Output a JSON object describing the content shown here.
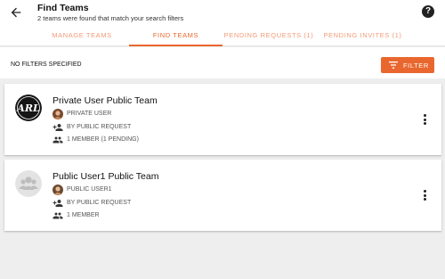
{
  "header": {
    "title": "Find Teams",
    "subtitle": "2 teams were found that match your search filters",
    "help_label": "?"
  },
  "tabs": [
    {
      "label": "MANAGE TEAMS",
      "active": false
    },
    {
      "label": "FIND TEAMS",
      "active": true
    },
    {
      "label": "PENDING REQUESTS (1)",
      "active": false
    },
    {
      "label": "PENDING INVITES (1)",
      "active": false
    }
  ],
  "filters": {
    "status": "NO FILTERS SPECIFIED",
    "button_label": "FILTER"
  },
  "teams": [
    {
      "name": "Private User Public Team",
      "avatar_text": "ARL",
      "owner": "PRIVATE USER",
      "join_type": "BY PUBLIC REQUEST",
      "members": "1 MEMBER (1 PENDING)"
    },
    {
      "name": "Public User1 Public Team",
      "owner": "PUBLIC USER1",
      "join_type": "BY PUBLIC REQUEST",
      "members": "1 MEMBER"
    }
  ],
  "colors": {
    "accent": "#e9672e",
    "accent_light": "#f29a76",
    "background": "#eeeeee"
  },
  "icons": {
    "back": "arrow-left-icon",
    "help": "help-circle-icon",
    "filter": "filter-list-icon",
    "join": "person-add-icon",
    "members": "group-icon",
    "more": "more-vert-icon"
  }
}
